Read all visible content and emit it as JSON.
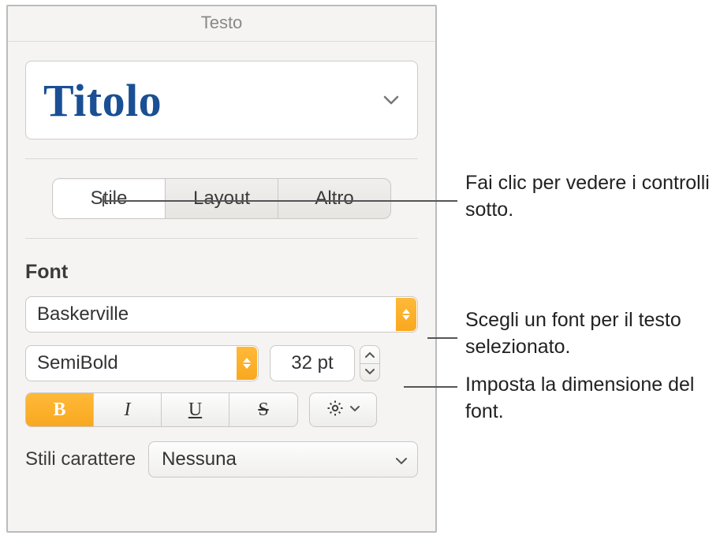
{
  "panel": {
    "title": "Testo",
    "paragraph_style": "Titolo"
  },
  "tabs": {
    "style": "Stile",
    "layout": "Layout",
    "more": "Altro"
  },
  "font": {
    "section_label": "Font",
    "family": "Baskerville",
    "weight": "SemiBold",
    "size_display": "32 pt"
  },
  "style_buttons": {
    "bold": "B",
    "italic": "I",
    "underline": "U",
    "strike": "S"
  },
  "char_styles": {
    "label": "Stili carattere",
    "value": "Nessuna"
  },
  "callouts": {
    "tabs": "Fai clic per vedere i controlli sotto.",
    "font": "Scegli un font per il testo selezionato.",
    "size": "Imposta la dimensione del font."
  }
}
